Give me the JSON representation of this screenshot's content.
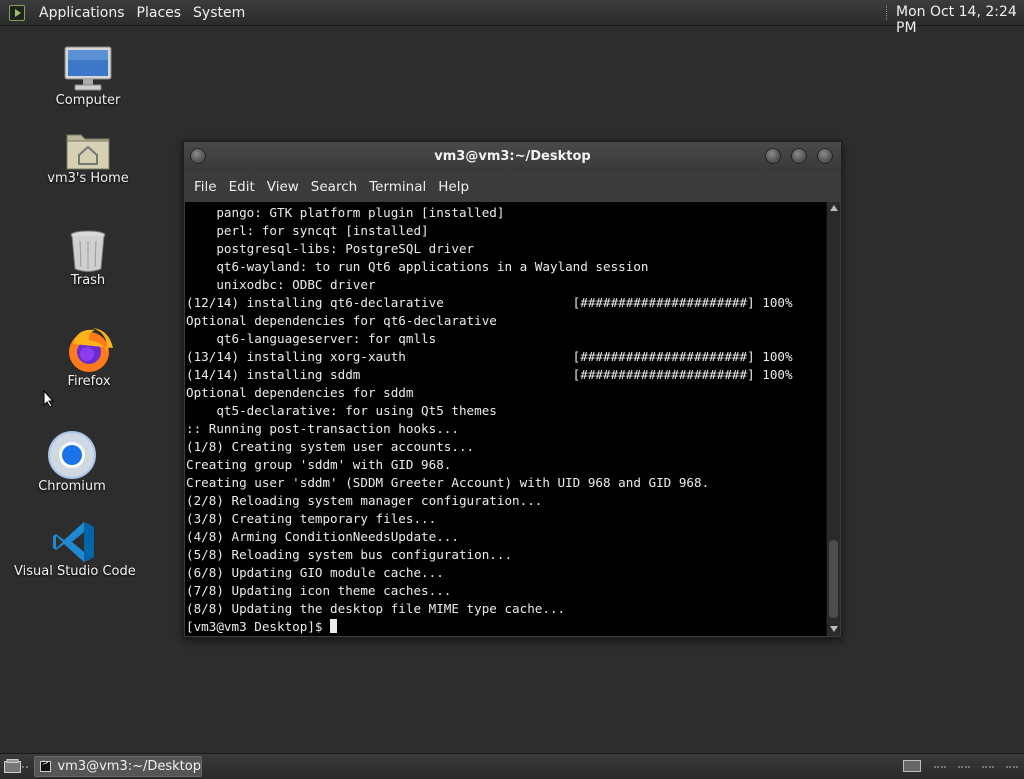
{
  "top_panel": {
    "menus": [
      "Applications",
      "Places",
      "System"
    ],
    "clock": "Mon Oct 14,  2:24 PM"
  },
  "desktop_icons": [
    {
      "label": "Computer",
      "icon": "computer-icon"
    },
    {
      "label": "vm3's Home",
      "icon": "home-folder-icon"
    },
    {
      "label": "Trash",
      "icon": "trash-icon"
    },
    {
      "label": "Firefox",
      "icon": "firefox-icon"
    },
    {
      "label": "Chromium",
      "icon": "chromium-icon"
    },
    {
      "label": "Visual Studio Code",
      "icon": "vscode-icon"
    }
  ],
  "terminal": {
    "title": "vm3@vm3:~/Desktop",
    "menu": [
      "File",
      "Edit",
      "View",
      "Search",
      "Terminal",
      "Help"
    ],
    "lines": [
      "    pango: GTK platform plugin [installed]",
      "    perl: for syncqt [installed]",
      "    postgresql-libs: PostgreSQL driver",
      "    qt6-wayland: to run Qt6 applications in a Wayland session",
      "    unixodbc: ODBC driver",
      "(12/14) installing qt6-declarative                 [######################] 100%",
      "Optional dependencies for qt6-declarative",
      "    qt6-languageserver: for qmlls",
      "(13/14) installing xorg-xauth                      [######################] 100%",
      "(14/14) installing sddm                            [######################] 100%",
      "Optional dependencies for sddm",
      "    qt5-declarative: for using Qt5 themes",
      ":: Running post-transaction hooks...",
      "(1/8) Creating system user accounts...",
      "Creating group 'sddm' with GID 968.",
      "Creating user 'sddm' (SDDM Greeter Account) with UID 968 and GID 968.",
      "(2/8) Reloading system manager configuration...",
      "(3/8) Creating temporary files...",
      "(4/8) Arming ConditionNeedsUpdate...",
      "(5/8) Reloading system bus configuration...",
      "(6/8) Updating GIO module cache...",
      "(7/8) Updating icon theme caches...",
      "(8/8) Updating the desktop file MIME type cache...",
      "[vm3@vm3 Desktop]$ "
    ]
  },
  "taskbar": {
    "task_label": "vm3@vm3:~/Desktop"
  }
}
